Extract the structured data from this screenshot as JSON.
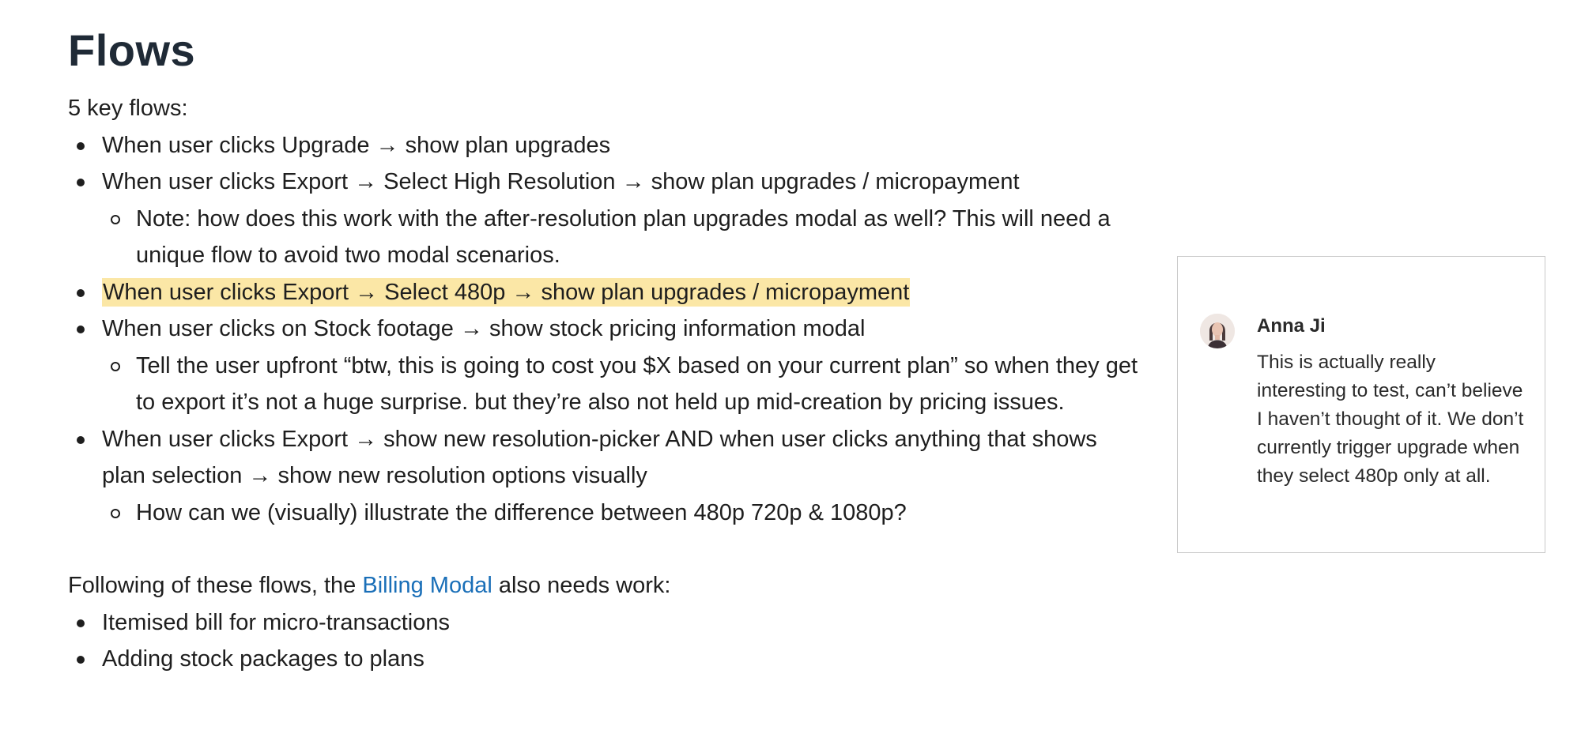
{
  "doc": {
    "title": "Flows",
    "intro": "5 key flows:",
    "flows": [
      {
        "text": "When user clicks Upgrade → show plan upgrades"
      },
      {
        "text": "When user clicks Export → Select High Resolution → show plan upgrades / micropayment",
        "note": "Note: how does this work with the after-resolution plan upgrades modal as well? This will need a unique flow to avoid two modal scenarios."
      },
      {
        "text": "When user clicks Export → Select 480p → show plan upgrades / micropayment"
      },
      {
        "text": "When user clicks on Stock footage → show stock pricing information modal",
        "note": "Tell the user upfront “btw, this is going to cost you $X based on your current plan” so when they get to export it’s not a huge surprise. but they’re also not held up mid-creation by pricing issues."
      },
      {
        "text": "When user clicks Export → show new resolution-picker AND when user clicks anything that shows plan selection → show new resolution options visually",
        "note": "How can we (visually) illustrate the difference between 480p 720p & 1080p?"
      }
    ],
    "following": {
      "prefix": "Following of these flows, the ",
      "link": "Billing Modal",
      "suffix": " also needs work:"
    },
    "billing_items": [
      "Itemised bill for micro-transactions",
      "Adding stock packages to plans"
    ]
  },
  "comment": {
    "author": "Anna Ji",
    "body": "This is actually really interesting to test, can’t believe I haven’t thought of it. We don’t currently trigger upgrade when they select 480p only at all."
  },
  "colors": {
    "highlight": "#fbe7a6",
    "link": "#1a6fb8",
    "title": "#1f2a36"
  }
}
